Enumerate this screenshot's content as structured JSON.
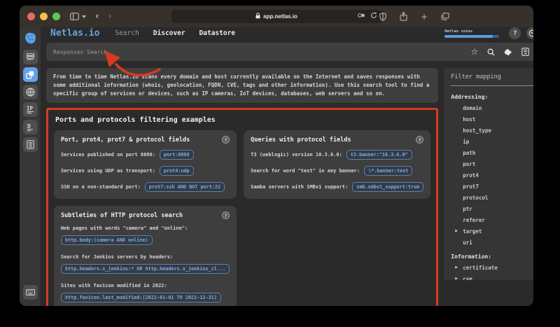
{
  "browser": {
    "url": "app.netlas.io"
  },
  "glyphs": {
    "help": "?",
    "plus": "+",
    "back": "‹",
    "forward": "›",
    "star": "☆"
  },
  "rail": {
    "host_label": "host",
    "ip_label": "IP",
    "dns_label": "D"
  },
  "header": {
    "logo": "Netlas.io",
    "nav": [
      {
        "label": "Search",
        "active": true
      },
      {
        "label": "Discover",
        "active": false
      },
      {
        "label": "Datastore",
        "active": false
      }
    ],
    "coins_label": "Netlas coins"
  },
  "search_bar": {
    "placeholder": "Responses Search"
  },
  "intro": {
    "text": "From time to time Netlas.io scans every domain and host currently available on the Internet and saves responses with some additional information (whois, geolocation, FQDN, CVE, tags and other information). Use this search tool to find a specific group of services or devices, such as IP cameras, IoT devices, databases, web servers and so on."
  },
  "section": {
    "title": "Ports and protocols filtering examples",
    "cards": [
      {
        "title": "Port, prot4, prot7 & protocol fields",
        "layout": "inline",
        "rows": [
          {
            "label": "Services published on port 8080:",
            "query": "port:8080"
          },
          {
            "label": "Services using UDP as transport:",
            "query": "prot4:udp"
          },
          {
            "label": "SSH on a non-standard port:",
            "query": "prot7:ssh AND NOT port:22"
          }
        ]
      },
      {
        "title": "Queries with protocol fields",
        "layout": "inline",
        "rows": [
          {
            "label": "T3 (weblogic) version 10.3.6.0:",
            "query": "t3.banner:\"10.3.6.0\""
          },
          {
            "label": "Search for word \"test\" in any banner:",
            "query": "\\*.banner:test"
          },
          {
            "label": "Samba servers with SMBv1 support:",
            "query": "smb.smbv1_support:true"
          }
        ]
      },
      {
        "title": "Subtleties of HTTP protocol search",
        "layout": "stacked",
        "rows": [
          {
            "label": "Web pages with words \"camera\" and \"online\":",
            "query": "http.body:(camera AND online)"
          },
          {
            "label": "Search for Jenkins servers by headers:",
            "query": "http.headers.x_jenkins:* OR http.headers.x_jenkins_cl..."
          },
          {
            "label": "Sites with favicon modified in 2022:",
            "query": "http.favicon.last_modified:[2022-01-01 TO 2022-12-31]"
          }
        ]
      }
    ]
  },
  "filter_mapping": {
    "title": "Filter mapping",
    "groups": [
      {
        "label": "Addressing:",
        "items": [
          {
            "label": "domain"
          },
          {
            "label": "host"
          },
          {
            "label": "host_type"
          },
          {
            "label": "ip"
          },
          {
            "label": "path"
          },
          {
            "label": "port"
          },
          {
            "label": "prot4"
          },
          {
            "label": "prot7"
          },
          {
            "label": "protocol"
          },
          {
            "label": "ptr"
          },
          {
            "label": "referer"
          },
          {
            "label": "target",
            "expandable": true
          },
          {
            "label": "uri"
          }
        ]
      },
      {
        "label": "Information:",
        "items": [
          {
            "label": "certificate",
            "expandable": true
          },
          {
            "label": "cve",
            "expandable": true
          }
        ]
      }
    ]
  },
  "colors": {
    "accent_blue": "#5e9be0",
    "annotation_red": "#d63a20",
    "traffic": [
      "#ed6a5e",
      "#f4bf4f",
      "#61c554"
    ]
  }
}
